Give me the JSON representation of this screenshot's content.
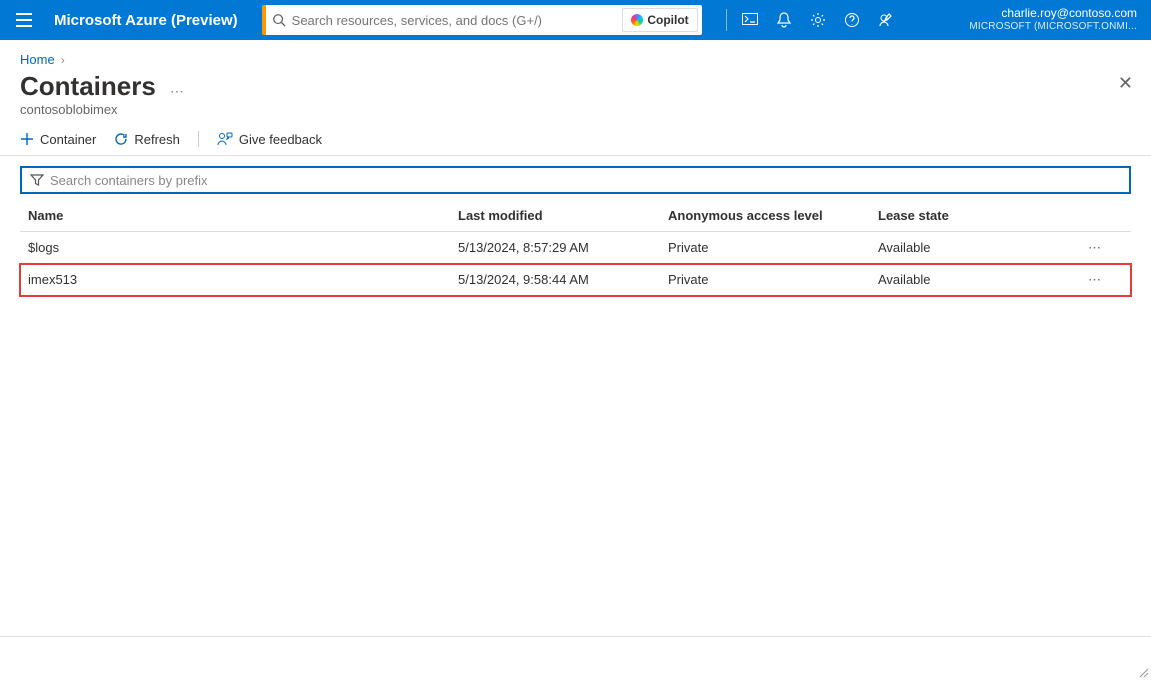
{
  "header": {
    "brand": "Microsoft Azure (Preview)",
    "search_placeholder": "Search resources, services, and docs (G+/)",
    "copilot_label": "Copilot",
    "account_email": "charlie.roy@contoso.com",
    "account_tenant": "MICROSOFT (MICROSOFT.ONMI..."
  },
  "breadcrumb": {
    "home": "Home"
  },
  "page": {
    "title": "Containers",
    "subtitle": "contosoblobimex"
  },
  "toolbar": {
    "container_label": "Container",
    "refresh_label": "Refresh",
    "feedback_label": "Give feedback"
  },
  "filter": {
    "placeholder": "Search containers by prefix"
  },
  "table": {
    "headers": {
      "name": "Name",
      "last_modified": "Last modified",
      "access": "Anonymous access level",
      "lease": "Lease state"
    },
    "rows": [
      {
        "name": "$logs",
        "last_modified": "5/13/2024, 8:57:29 AM",
        "access": "Private",
        "lease": "Available",
        "highlight": false
      },
      {
        "name": "imex513",
        "last_modified": "5/13/2024, 9:58:44 AM",
        "access": "Private",
        "lease": "Available",
        "highlight": true
      }
    ]
  }
}
